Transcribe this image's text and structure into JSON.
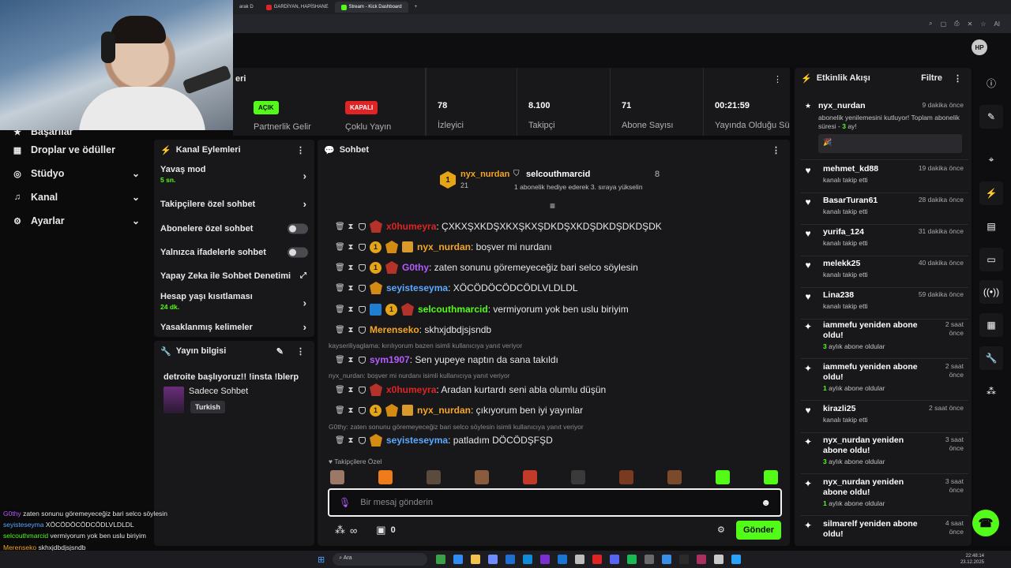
{
  "browser": {
    "tabs": [
      {
        "label": "arak D",
        "color": "#888"
      },
      {
        "label": "GARDİYAN, HAPİSHANE",
        "color": "#e02424"
      },
      {
        "label": "Stream - Kick Dashboard",
        "color": "#53fc18"
      }
    ],
    "new_tab": "+",
    "toolbar_icons": [
      "⌕",
      "▢",
      "⎙",
      "✕",
      "☆",
      "AI"
    ]
  },
  "leftnav": {
    "partial_item": "Başarılar",
    "items": [
      {
        "label": "Droplar ve ödüller",
        "icon": "▦"
      },
      {
        "label": "Stüdyo",
        "icon": "◎",
        "chevron": "⌄"
      },
      {
        "label": "Kanal",
        "icon": "♫",
        "chevron": "⌄"
      },
      {
        "label": "Ayarlar",
        "icon": "⚙",
        "chevron": "⌄"
      }
    ]
  },
  "stats": {
    "title_partial": "eri",
    "partner": {
      "badge": "AÇIK",
      "label": "Partnerlik Gelir"
    },
    "multi": {
      "badge": "KAPALI",
      "label": "Çoklu Yayın"
    },
    "viewers": {
      "value": "78",
      "label": "İzleyici"
    },
    "followers": {
      "value": "8.100",
      "label": "Takipçi"
    },
    "subs": {
      "value": "71",
      "label": "Abone Sayısı"
    },
    "uptime": {
      "value": "00:21:59",
      "label": "Yayında Olduğu Sür"
    }
  },
  "actions": {
    "title": "Kanal Eylemleri",
    "slow": {
      "label": "Yavaş mod",
      "sub": "5 sn."
    },
    "followers_only": "Takipçilere özel sohbet",
    "subs_only": "Abonelere özel sohbet",
    "emote_only": "Yalnızca ifadelerle sohbet",
    "ai_mod": "Yapay Zeka ile Sohbet Denetimi",
    "age": {
      "label": "Hesap yaşı kısıtlaması",
      "sub": "24 dk."
    },
    "banned_words": "Yasaklanmış kelimeler"
  },
  "streaminfo": {
    "title": "Yayın bilgisi",
    "stream_title": "detroite başlıyoruz!! !insta !blerp",
    "category": "Sadece Sohbet",
    "language": "Turkish"
  },
  "chat": {
    "title": "Sohbet",
    "pinned": {
      "user1": "nyx_nurdan",
      "user1_count": "21",
      "user2": "selcouthmarcid",
      "user2_count": "8",
      "description": "1 abonelik hediye ederek 3. sıraya yükselin"
    },
    "messages": [
      {
        "user": "x0humeyra",
        "color": "#e02424",
        "text": ": ÇXKXŞXKDŞXKXŞKXŞDKDŞXKDŞDKDŞDKDŞDK",
        "badges": [
          "bv"
        ]
      },
      {
        "user": "nyx_nurdan",
        "color": "#f5a623",
        "text": ": boşver mi nurdanı",
        "badges": [
          "b1",
          "bo",
          "bs"
        ]
      },
      {
        "user": "G0thy",
        "color": "#b55cff",
        "text": ": zaten sonunu göremeyeceğiz bari selco söylesin",
        "badges": [
          "b1",
          "bv"
        ]
      },
      {
        "user": "seyisteseyma",
        "color": "#5aa9ff",
        "text": ": XÖCÖDÖCÖDCÖDLVLDLDL",
        "badges": [
          "bo"
        ]
      },
      {
        "user": "selcouthmarcid",
        "color": "#53fc18",
        "text": ": vermiyorum yok ben uslu biriyim",
        "badges": [
          "bb",
          "b1",
          "bv"
        ]
      },
      {
        "user": "Merenseko",
        "color": "#f5a623",
        "text": ": skhxjdbdjsjsndb",
        "badges": []
      },
      {
        "user": "sym1907",
        "color": "#b55cff",
        "text": ": Sen yupeye naptın da sana takıldı",
        "badges": [],
        "reply": "kayseriliyaglama: kırılıyorum bazen isimli kullanıcıya yanıt veriyor"
      },
      {
        "user": "x0humeyra",
        "color": "#e02424",
        "text": ": Aradan kurtardı seni abla olumlu düşün",
        "badges": [
          "bv"
        ],
        "reply": "nyx_nurdan: boşver mi nurdanı isimli kullanıcıya yanıt veriyor"
      },
      {
        "user": "nyx_nurdan",
        "color": "#f5a623",
        "text": ": çıkıyorum ben iyi yayınlar",
        "badges": [
          "b1",
          "bo",
          "bs"
        ]
      },
      {
        "user": "seyisteseyma",
        "color": "#5aa9ff",
        "text": ": patladım DÖCÖDŞFŞD",
        "badges": [
          "bo"
        ],
        "reply": "G0thy: zaten sonunu göremeyeceğiz bari selco söylesin isimli kullanıcıya yanıt veriyor"
      }
    ],
    "followers_only_label": "Takipçilere Özel",
    "input_placeholder": "Bir mesaj gönderin",
    "infinity": "∞",
    "points": "0",
    "send": "Gönder"
  },
  "events": {
    "title": "Etkinlik Akışı",
    "filter": "Filtre",
    "sub_user": "nyx_nurdan",
    "sub_time": "9 dakika önce",
    "sub_text_a": "abonelik yenilemesini kutluyor! Toplam abonelik süresi - ",
    "sub_months": "3",
    "sub_text_b": " ay!",
    "items": [
      {
        "name": "mehmet_kd88",
        "time": "19 dakika önce",
        "desc": "kanalı takip etti",
        "type": "follow"
      },
      {
        "name": "BasarTuran61",
        "time": "28 dakika önce",
        "desc": "kanalı takip etti",
        "type": "follow"
      },
      {
        "name": "yurifa_124",
        "time": "31 dakika önce",
        "desc": "kanalı takip etti",
        "type": "follow"
      },
      {
        "name": "melekk25",
        "time": "40 dakika önce",
        "desc": "kanalı takip etti",
        "type": "follow"
      },
      {
        "name": "Lina238",
        "time": "59 dakika önce",
        "desc": "kanalı takip etti",
        "type": "follow"
      },
      {
        "name": "iammefu yeniden abone oldu!",
        "time": "2 saat önce",
        "months": "3",
        "desc": "aylık abone oldular",
        "type": "sub"
      },
      {
        "name": "iammefu yeniden abone oldu!",
        "time": "2 saat önce",
        "months": "1",
        "desc": "aylık abone oldular",
        "type": "sub"
      },
      {
        "name": "kirazli25",
        "time": "2 saat önce",
        "desc": "kanalı takip etti",
        "type": "follow"
      },
      {
        "name": "nyx_nurdan yeniden abone oldu!",
        "time": "3 saat önce",
        "months": "3",
        "desc": "aylık abone oldular",
        "type": "sub"
      },
      {
        "name": "nyx_nurdan yeniden abone oldu!",
        "time": "3 saat önce",
        "months": "1",
        "desc": "aylık abone oldular",
        "type": "sub"
      },
      {
        "name": "silmarelf yeniden abone oldu!",
        "time": "4 saat önce",
        "type": "sub"
      }
    ]
  },
  "overlay": [
    {
      "user": "G0thy",
      "color": "#b55cff",
      "text": "zaten sonunu göremeyeceğiz bari selco söylesin"
    },
    {
      "user": "seyisteseyma",
      "color": "#5aa9ff",
      "text": "XÖCÖDÖCÖDCÖDLVLDLDL"
    },
    {
      "user": "selcouthmarcid",
      "color": "#53fc18",
      "text": "vermiyorum yok ben uslu biriyim"
    },
    {
      "user": "Merenseko",
      "color": "#f5a623",
      "text": "skhxjdbdjsjsndb"
    },
    {
      "user": "nurdan",
      "color": "#f5a623",
      "text": "çıkıyorum ben iyi yayınlar"
    }
  ],
  "taskbar": {
    "search": "Ara",
    "time": "22:48:14",
    "date": "23.12.2025"
  },
  "colors": {
    "accent": "#53fc18",
    "danger": "#e02424",
    "panel": "#18181b"
  }
}
